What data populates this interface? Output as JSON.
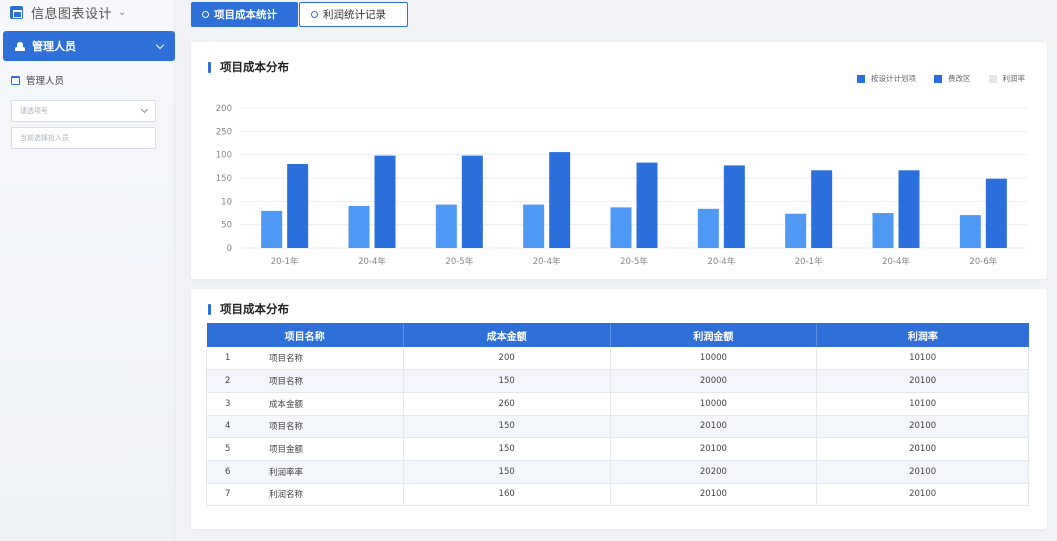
{
  "app": {
    "title": "信息图表设计",
    "caret": "⌄"
  },
  "sidebar": {
    "active_menu": {
      "label": "管理人员"
    },
    "sub_item": {
      "label": "管理人员"
    },
    "select": {
      "placeholder": "请选项号"
    },
    "input": {
      "placeholder": "当前选择投入员"
    }
  },
  "tabs": [
    {
      "label": "项目成本统计",
      "active": true
    },
    {
      "label": "利润统计记录",
      "active": false
    }
  ],
  "chart_card": {
    "title": "项目成本分布",
    "legend": [
      {
        "label": "按设计计划项",
        "color": "#2a6fdb"
      },
      {
        "label": "费改区",
        "color": "#2a6fdb"
      },
      {
        "label": "利润率",
        "color": "#e3e6eb"
      }
    ]
  },
  "chart_data": {
    "type": "bar",
    "categories": [
      "20-1年",
      "20-4年",
      "20-5年",
      "20-4年",
      "20-5年",
      "20-4年",
      "20-1年",
      "20-4年",
      "20-6年"
    ],
    "y_tick_labels": [
      "0",
      "50",
      "10",
      "150",
      "100",
      "250",
      "200"
    ],
    "series": [
      {
        "values": [
          53,
          60,
          62,
          62,
          58,
          56,
          49,
          50,
          47
        ],
        "color": "#4f98f4"
      },
      {
        "values": [
          120,
          132,
          132,
          137,
          122,
          118,
          111,
          111,
          99
        ],
        "color": "#2a6fdb"
      }
    ],
    "ylim": [
      0,
      200
    ],
    "grid": true,
    "legend_position": "top-right"
  },
  "table_card": {
    "title": "项目成本分布",
    "columns": [
      "项目名称",
      "成本金额",
      "利润金额",
      "利润率"
    ],
    "rows": [
      {
        "idx": "1",
        "name": "项目名称",
        "cost": "200",
        "profit": "10000",
        "rate": "10100"
      },
      {
        "idx": "2",
        "name": "项目名称",
        "cost": "150",
        "profit": "20000",
        "rate": "20100"
      },
      {
        "idx": "3",
        "name": "成本金额",
        "cost": "260",
        "profit": "10000",
        "rate": "10100"
      },
      {
        "idx": "4",
        "name": "项目名称",
        "cost": "150",
        "profit": "20100",
        "rate": "20100"
      },
      {
        "idx": "5",
        "name": "项目金额",
        "cost": "150",
        "profit": "20100",
        "rate": "20100"
      },
      {
        "idx": "6",
        "name": "利润率率",
        "cost": "150",
        "profit": "20200",
        "rate": "20100"
      },
      {
        "idx": "7",
        "name": "利润名称",
        "cost": "160",
        "profit": "20100",
        "rate": "20100"
      }
    ]
  }
}
